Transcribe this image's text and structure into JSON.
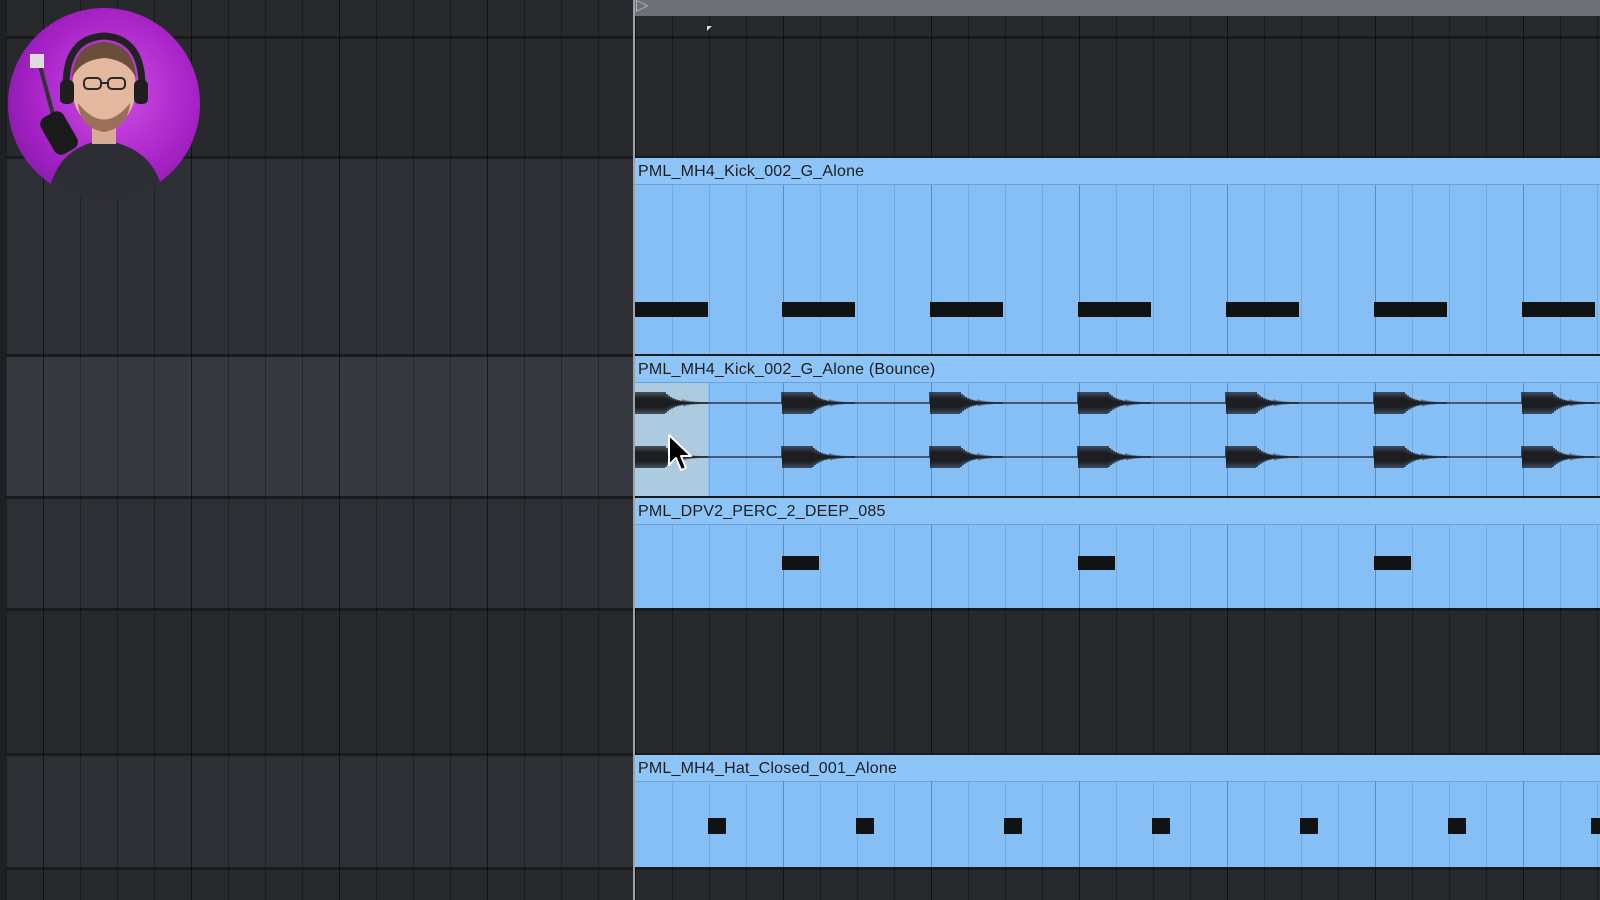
{
  "app": {
    "view": "Arrangement View"
  },
  "colors": {
    "clip": "#86bff6",
    "clip_header": "#8dc5f8",
    "note": "#111214",
    "background": "#27292d",
    "webcam_ring": "#b92fd8"
  },
  "tracks": [
    {
      "id": "track-1",
      "clip": null
    },
    {
      "id": "track-2",
      "clip": {
        "name": "PML_MH4_Kick_002_G_Alone",
        "kind": "midi"
      }
    },
    {
      "id": "track-3",
      "clip": {
        "name": "PML_MH4_Kick_002_G_Alone (Bounce)",
        "kind": "audio",
        "selected_region": true
      }
    },
    {
      "id": "track-4",
      "clip": {
        "name": "PML_DPV2_PERC_2_DEEP_085",
        "kind": "midi"
      }
    },
    {
      "id": "track-5",
      "clip": null
    },
    {
      "id": "track-6",
      "clip": {
        "name": "PML_MH4_Hat_Closed_001_Alone",
        "kind": "midi"
      }
    }
  ],
  "icons": {
    "loop": "loop-brace-icon",
    "cursor": "mouse-pointer-icon",
    "webcam": "presenter-webcam-overlay"
  }
}
